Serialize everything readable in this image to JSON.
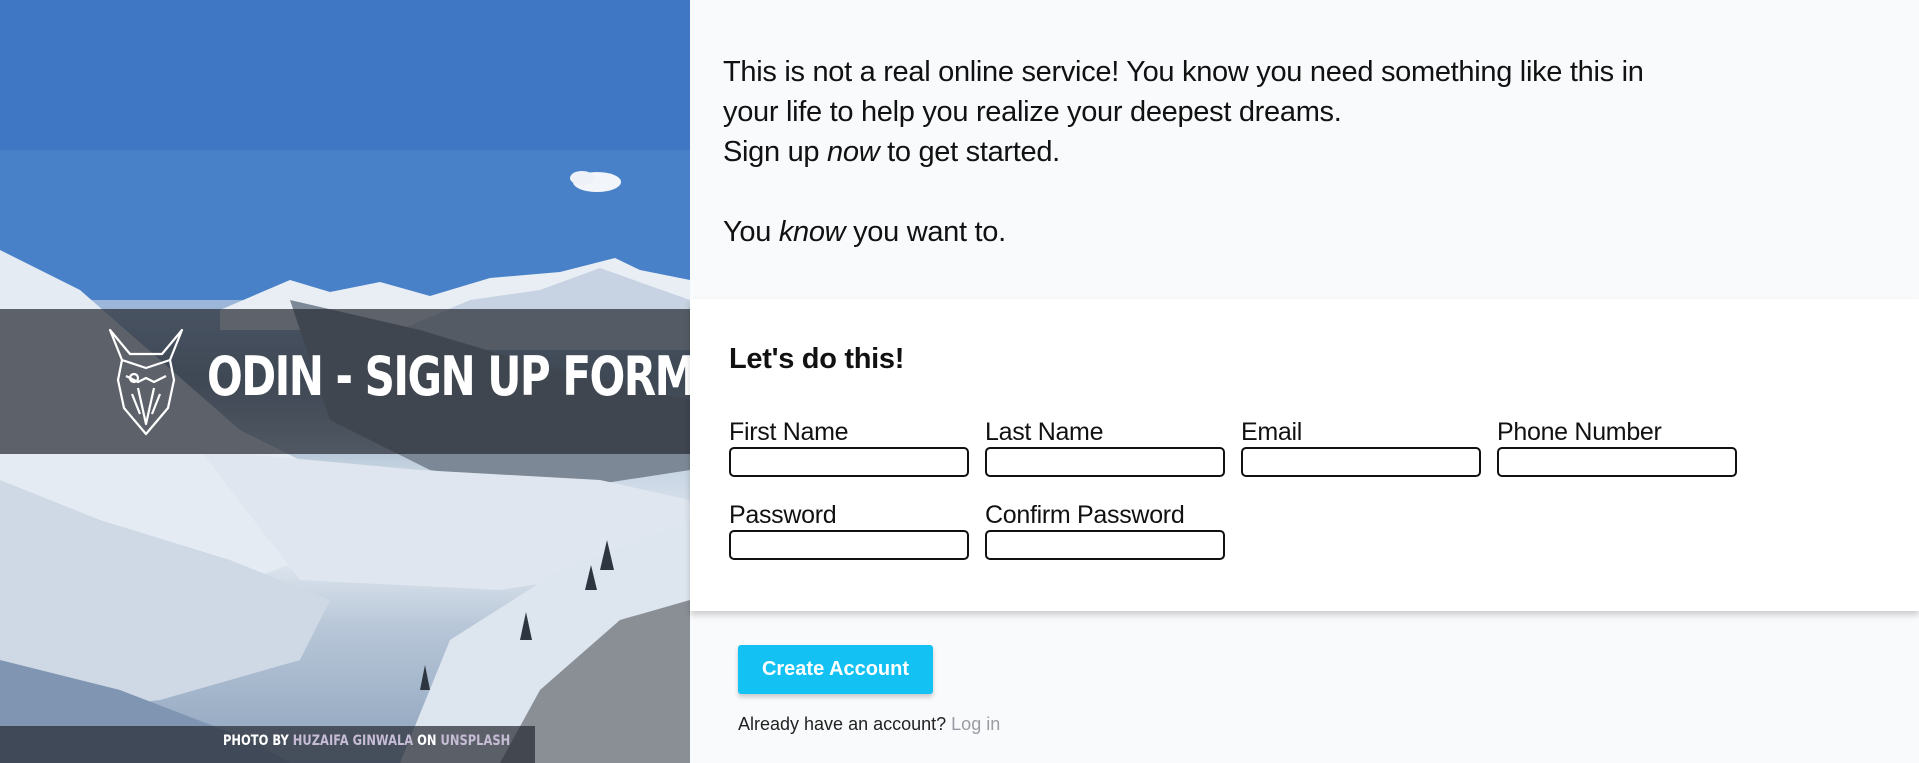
{
  "hero": {
    "title": "ODIN - SIGN UP FORM",
    "credit_prefix": "PHOTO BY",
    "credit_author": "HUZAIFA GINWALA",
    "credit_mid": "ON",
    "credit_site": "UNSPLASH",
    "logo_icon": "odin-helmet-logo"
  },
  "intro": {
    "line1": "This is not a real online service! You know you need something like this in your life to help you realize your deepest dreams.",
    "line2_a": "Sign up",
    "line2_em": "now",
    "line2_b": "to get started.",
    "line3_a": "You",
    "line3_em": "know",
    "line3_b": "you want to."
  },
  "form": {
    "heading": "Let's do this!",
    "fields": [
      {
        "label": "First Name",
        "value": ""
      },
      {
        "label": "Last Name",
        "value": ""
      },
      {
        "label": "Email",
        "value": ""
      },
      {
        "label": "Phone Number",
        "value": ""
      },
      {
        "label": "Password",
        "value": ""
      },
      {
        "label": "Confirm Password",
        "value": ""
      }
    ]
  },
  "actions": {
    "create_label": "Create Account",
    "login_prompt": "Already have an account?",
    "login_link": "Log in"
  },
  "colors": {
    "accent": "#14c1f3",
    "link_muted": "#9b9ba3",
    "band": "#282c34"
  }
}
